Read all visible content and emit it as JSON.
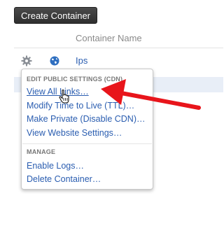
{
  "toolbar": {
    "create_label": "Create Container"
  },
  "table": {
    "column_header": "Container Name",
    "rows": [
      {
        "name": "Ips"
      }
    ]
  },
  "menu": {
    "section1_heading": "EDIT PUBLIC SETTINGS (CDN)",
    "section1_items": [
      "View All Links…",
      "Modify Time to Live (TTL)…",
      "Make Private (Disable CDN)…",
      "View Website Settings…"
    ],
    "section2_heading": "MANAGE",
    "section2_items": [
      "Enable Logs…",
      "Delete Container…"
    ]
  },
  "colors": {
    "link": "#2a5db0",
    "arrow": "#e8151b",
    "button": "#3a3a3a"
  },
  "icons": {
    "gear": "gear-icon",
    "globe": "globe-icon",
    "cursor": "hand-cursor-icon"
  }
}
